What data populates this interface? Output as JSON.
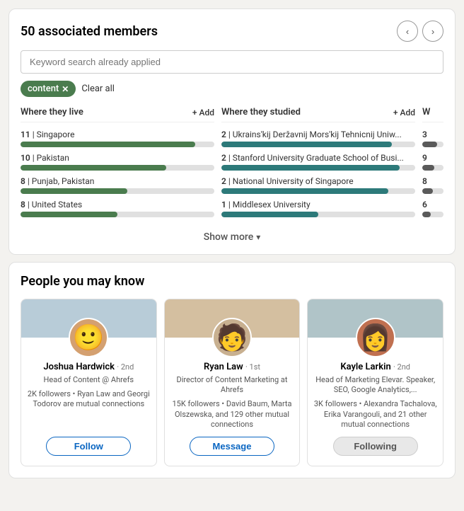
{
  "associated_members": {
    "title": "50 associated members",
    "search_placeholder": "Keyword search already applied",
    "filter_tag": "content",
    "clear_all_label": "Clear all",
    "nav_prev_label": "‹",
    "nav_next_label": "›",
    "col_live": {
      "header": "Where they live",
      "add_label": "+ Add",
      "items": [
        {
          "count": "11",
          "label": "Singapore",
          "bar_pct": 90
        },
        {
          "count": "10",
          "label": "Pakistan",
          "bar_pct": 75
        },
        {
          "count": "8",
          "label": "Punjab, Pakistan",
          "bar_pct": 55
        },
        {
          "count": "8",
          "label": "United States",
          "bar_pct": 50
        }
      ]
    },
    "col_studied": {
      "header": "Where they studied",
      "add_label": "+ Add",
      "items": [
        {
          "count": "2",
          "label": "Ukrains'kij Deržavnij Mors'kij Tehnicnij Uniw...",
          "bar_pct": 88
        },
        {
          "count": "2",
          "label": "Stanford University Graduate School of Busi...",
          "bar_pct": 92
        },
        {
          "count": "2",
          "label": "National University of Singapore",
          "bar_pct": 86
        },
        {
          "count": "1",
          "label": "Middlesex University",
          "bar_pct": 50
        }
      ]
    },
    "col_third": {
      "header": "W",
      "add_label": "",
      "items": [
        {
          "count": "3",
          "bar_pct": 70
        },
        {
          "count": "9",
          "bar_pct": 55
        },
        {
          "count": "8",
          "bar_pct": 50
        },
        {
          "count": "6",
          "bar_pct": 40
        }
      ]
    },
    "show_more_label": "Show more",
    "show_more_chevron": "▾"
  },
  "pymk": {
    "title": "People you may know",
    "people": [
      {
        "id": "joshua",
        "name": "Joshua Hardwick",
        "degree": "2nd",
        "job_title": "Head of Content @ Ahrefs",
        "followers_info": "2K followers • Ryan Law and Georgi Todorov are mutual connections",
        "action_label": "Follow",
        "action_type": "follow",
        "avatar_emoji": "😊"
      },
      {
        "id": "ryan",
        "name": "Ryan Law",
        "degree": "1st",
        "job_title": "Director of Content Marketing at Ahrefs",
        "followers_info": "15K followers • David Baum, Marta Olszewska, and 129 other mutual connections",
        "action_label": "Message",
        "action_type": "message",
        "avatar_emoji": "🧑"
      },
      {
        "id": "kayle",
        "name": "Kayle Larkin",
        "degree": "2nd",
        "job_title": "Head of Marketing Elevar. Speaker, SEO, Google Analytics,...",
        "followers_info": "3K followers • Alexandra Tachalova, Erika Varangouli, and 21 other mutual connections",
        "action_label": "Following",
        "action_type": "following",
        "avatar_emoji": "👩"
      }
    ]
  }
}
